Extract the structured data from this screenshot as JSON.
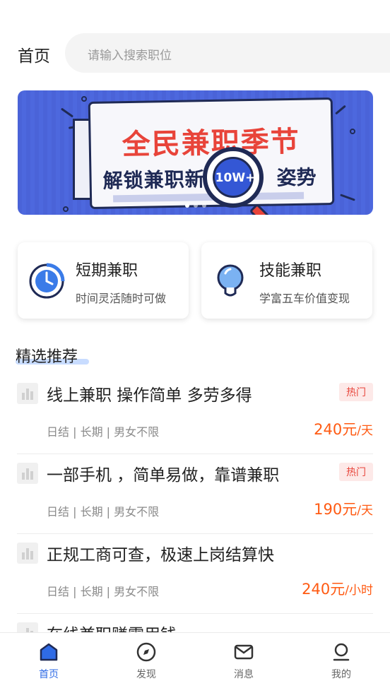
{
  "header": {
    "title": "首页",
    "search_placeholder": "请输入搜索职位"
  },
  "banner": {
    "title": "全民兼职季节",
    "subtitle_left": "解锁兼职新",
    "subtitle_right": "姿势",
    "badge": "10W+",
    "slide_count": 3,
    "active_slide": 1
  },
  "categories": [
    {
      "title": "短期兼职",
      "subtitle": "时间灵活随时可做",
      "icon": "clock-icon"
    },
    {
      "title": "技能兼职",
      "subtitle": "学富五车价值变现",
      "icon": "lightbulb-icon"
    }
  ],
  "section": {
    "title": "精选推荐"
  },
  "jobs": [
    {
      "title": "线上兼职  操作简单  多劳多得",
      "tag": "热门",
      "meta": "日结 | 长期 | 男女不限",
      "salary": "240元",
      "unit": "/天"
    },
    {
      "title": "一部手机 ，简单易做，靠谱兼职",
      "tag": "热门",
      "meta": "日结 | 长期 | 男女不限",
      "salary": "190元",
      "unit": "/天"
    },
    {
      "title": "正规工商可查，极速上岗结算快",
      "tag": "",
      "meta": "日结 | 长期 | 男女不限",
      "salary": "240元",
      "unit": "/小时"
    },
    {
      "title": "在线兼职赚零用钱",
      "tag": "",
      "meta": "",
      "salary": "",
      "unit": ""
    }
  ],
  "nav": {
    "items": [
      {
        "label": "首页",
        "icon": "home-icon",
        "active": true
      },
      {
        "label": "发现",
        "icon": "compass-icon",
        "active": false
      },
      {
        "label": "消息",
        "icon": "mail-icon",
        "active": false
      },
      {
        "label": "我的",
        "icon": "user-icon",
        "active": false
      }
    ],
    "active_color": "#2f6be6"
  },
  "colors": {
    "accent": "#2f6be6",
    "salary": "#ff5a12",
    "hot_tag": "#e8443a"
  }
}
